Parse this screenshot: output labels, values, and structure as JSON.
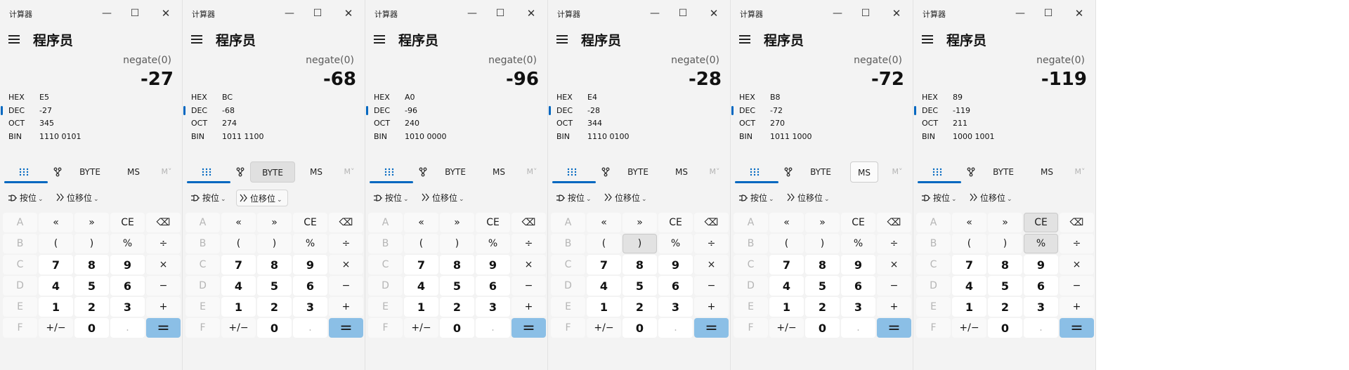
{
  "app_title": "计算器",
  "mode_title": "程序员",
  "caption": {
    "minimize": "—",
    "maximize": "☐",
    "close": "✕"
  },
  "radix_labels": [
    "HEX",
    "DEC",
    "OCT",
    "BIN"
  ],
  "tabs": {
    "byte": "BYTE",
    "ms": "MS",
    "mdown": "M˅"
  },
  "dropdowns": {
    "bitwise": "按位",
    "bitshift": "位移位"
  },
  "keys": [
    [
      "A",
      "«",
      "»",
      "CE",
      "⌫"
    ],
    [
      "B",
      "(",
      ")",
      "%",
      "÷"
    ],
    [
      "C",
      "7",
      "8",
      "9",
      "×"
    ],
    [
      "D",
      "4",
      "5",
      "6",
      "−"
    ],
    [
      "E",
      "1",
      "2",
      "3",
      "+"
    ],
    [
      "F",
      "+/−",
      "0",
      ".",
      "="
    ]
  ],
  "icons": {
    "menu": "hamburger-icon",
    "keypad": "keypad-icon",
    "bit_toggle": "bit-toggle-icon",
    "bitwise": "bitwise-icon",
    "bitshift": "bitshift-icon",
    "backspace": "backspace-icon"
  },
  "colors": {
    "accent": "#0067c0",
    "equals": "#8bbfe6"
  },
  "windows": [
    {
      "expression": "negate(0)",
      "result": "-27",
      "hex": "E5",
      "dec": "-27",
      "oct": "345",
      "bin": "1110 0101",
      "highlight_tab": "",
      "highlight_keys": [],
      "boxed_dropdown": false
    },
    {
      "expression": "negate(0)",
      "result": "-68",
      "hex": "BC",
      "dec": "-68",
      "oct": "274",
      "bin": "1011 1100",
      "highlight_tab": "byte",
      "highlight_keys": [],
      "boxed_dropdown": true
    },
    {
      "expression": "negate(0)",
      "result": "-96",
      "hex": "A0",
      "dec": "-96",
      "oct": "240",
      "bin": "1010 0000",
      "highlight_tab": "",
      "highlight_keys": [],
      "boxed_dropdown": false
    },
    {
      "expression": "negate(0)",
      "result": "-28",
      "hex": "E4",
      "dec": "-28",
      "oct": "344",
      "bin": "1110 0100",
      "highlight_tab": "",
      "highlight_keys": [
        "1,2"
      ],
      "boxed_dropdown": false
    },
    {
      "expression": "negate(0)",
      "result": "-72",
      "hex": "B8",
      "dec": "-72",
      "oct": "270",
      "bin": "1011 1000",
      "highlight_tab": "ms",
      "highlight_keys": [],
      "boxed_dropdown": false
    },
    {
      "expression": "negate(0)",
      "result": "-119",
      "hex": "89",
      "dec": "-119",
      "oct": "211",
      "bin": "1000 1001",
      "highlight_tab": "",
      "highlight_keys": [
        "0,3",
        "1,3"
      ],
      "boxed_dropdown": false
    }
  ]
}
